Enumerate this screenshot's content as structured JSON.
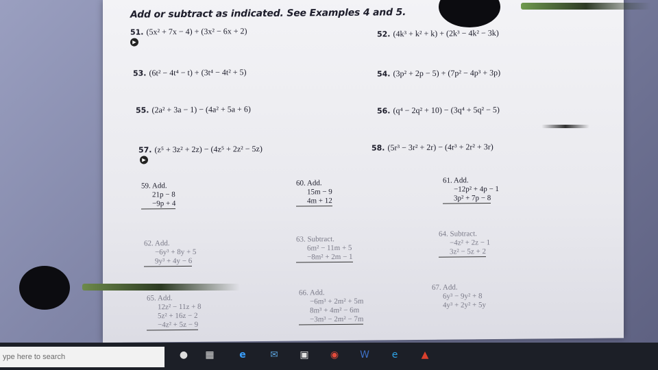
{
  "instructions": "Add or subtract as indicated. See Examples 4 and 5.",
  "problems": [
    {
      "num": "51.",
      "expr": "(5x² + 7x − 4) + (3x² − 6x + 2)"
    },
    {
      "num": "52.",
      "expr": "(4k³ + k² + k) + (2k³ − 4k² − 3k)"
    },
    {
      "num": "53.",
      "expr": "(6t² − 4t⁴ − t) + (3t⁴ − 4t² + 5)"
    },
    {
      "num": "54.",
      "expr": "(3p² + 2p − 5) + (7p² − 4p³ + 3p)"
    },
    {
      "num": "55.",
      "expr": "(2a² + 3a − 1) − (4a² + 5a + 6)"
    },
    {
      "num": "56.",
      "expr": "(q⁴ − 2q² + 10) − (3q⁴ + 5q² − 5)"
    },
    {
      "num": "57.",
      "expr": "(z⁵ + 3z² + 2z) − (4z⁵ + 2z² − 5z)"
    },
    {
      "num": "58.",
      "expr": "(5r³ − 3r² + 2r) − (4r³ + 2r² + 3r)"
    }
  ],
  "columns": [
    {
      "head": "59. Add.",
      "lines": [
        "21p − 8",
        "−9p + 4"
      ]
    },
    {
      "head": "60. Add.",
      "lines": [
        "15m − 9",
        "4m + 12"
      ]
    },
    {
      "head": "61. Add.",
      "lines": [
        "−12p² + 4p − 1",
        "3p² + 7p − 8"
      ]
    },
    {
      "head": "62. Add.",
      "lines": [
        "−6y³ + 8y + 5",
        "9y³ + 4y − 6"
      ]
    },
    {
      "head": "63. Subtract.",
      "lines": [
        "6m² − 11m + 5",
        "−8m² + 2m − 1"
      ]
    },
    {
      "head": "64. Subtract.",
      "lines": [
        "−4z² + 2z − 1",
        "3z² − 5z + 2"
      ]
    },
    {
      "head": "65. Add.",
      "lines": [
        "12z² − 11z + 8",
        "5z² + 16z − 2",
        "−4z² + 5z − 9"
      ]
    },
    {
      "head": "66. Add.",
      "lines": [
        "−6m³ + 2m² + 5m",
        "8m³ + 4m² − 6m",
        "−3m³ − 2m² − 7m"
      ]
    },
    {
      "head": "67. Add.",
      "lines": [
        "6y³ − 9y² + 8",
        "4y³ + 2y² + 5y"
      ]
    }
  ],
  "taskbar": {
    "search_placeholder": "ype here to search",
    "icons": [
      "microphone-icon",
      "task-view-icon",
      "edge-icon",
      "mail-icon",
      "store-icon",
      "chrome-icon",
      "word-icon",
      "ie-icon",
      "pdf-icon"
    ]
  }
}
